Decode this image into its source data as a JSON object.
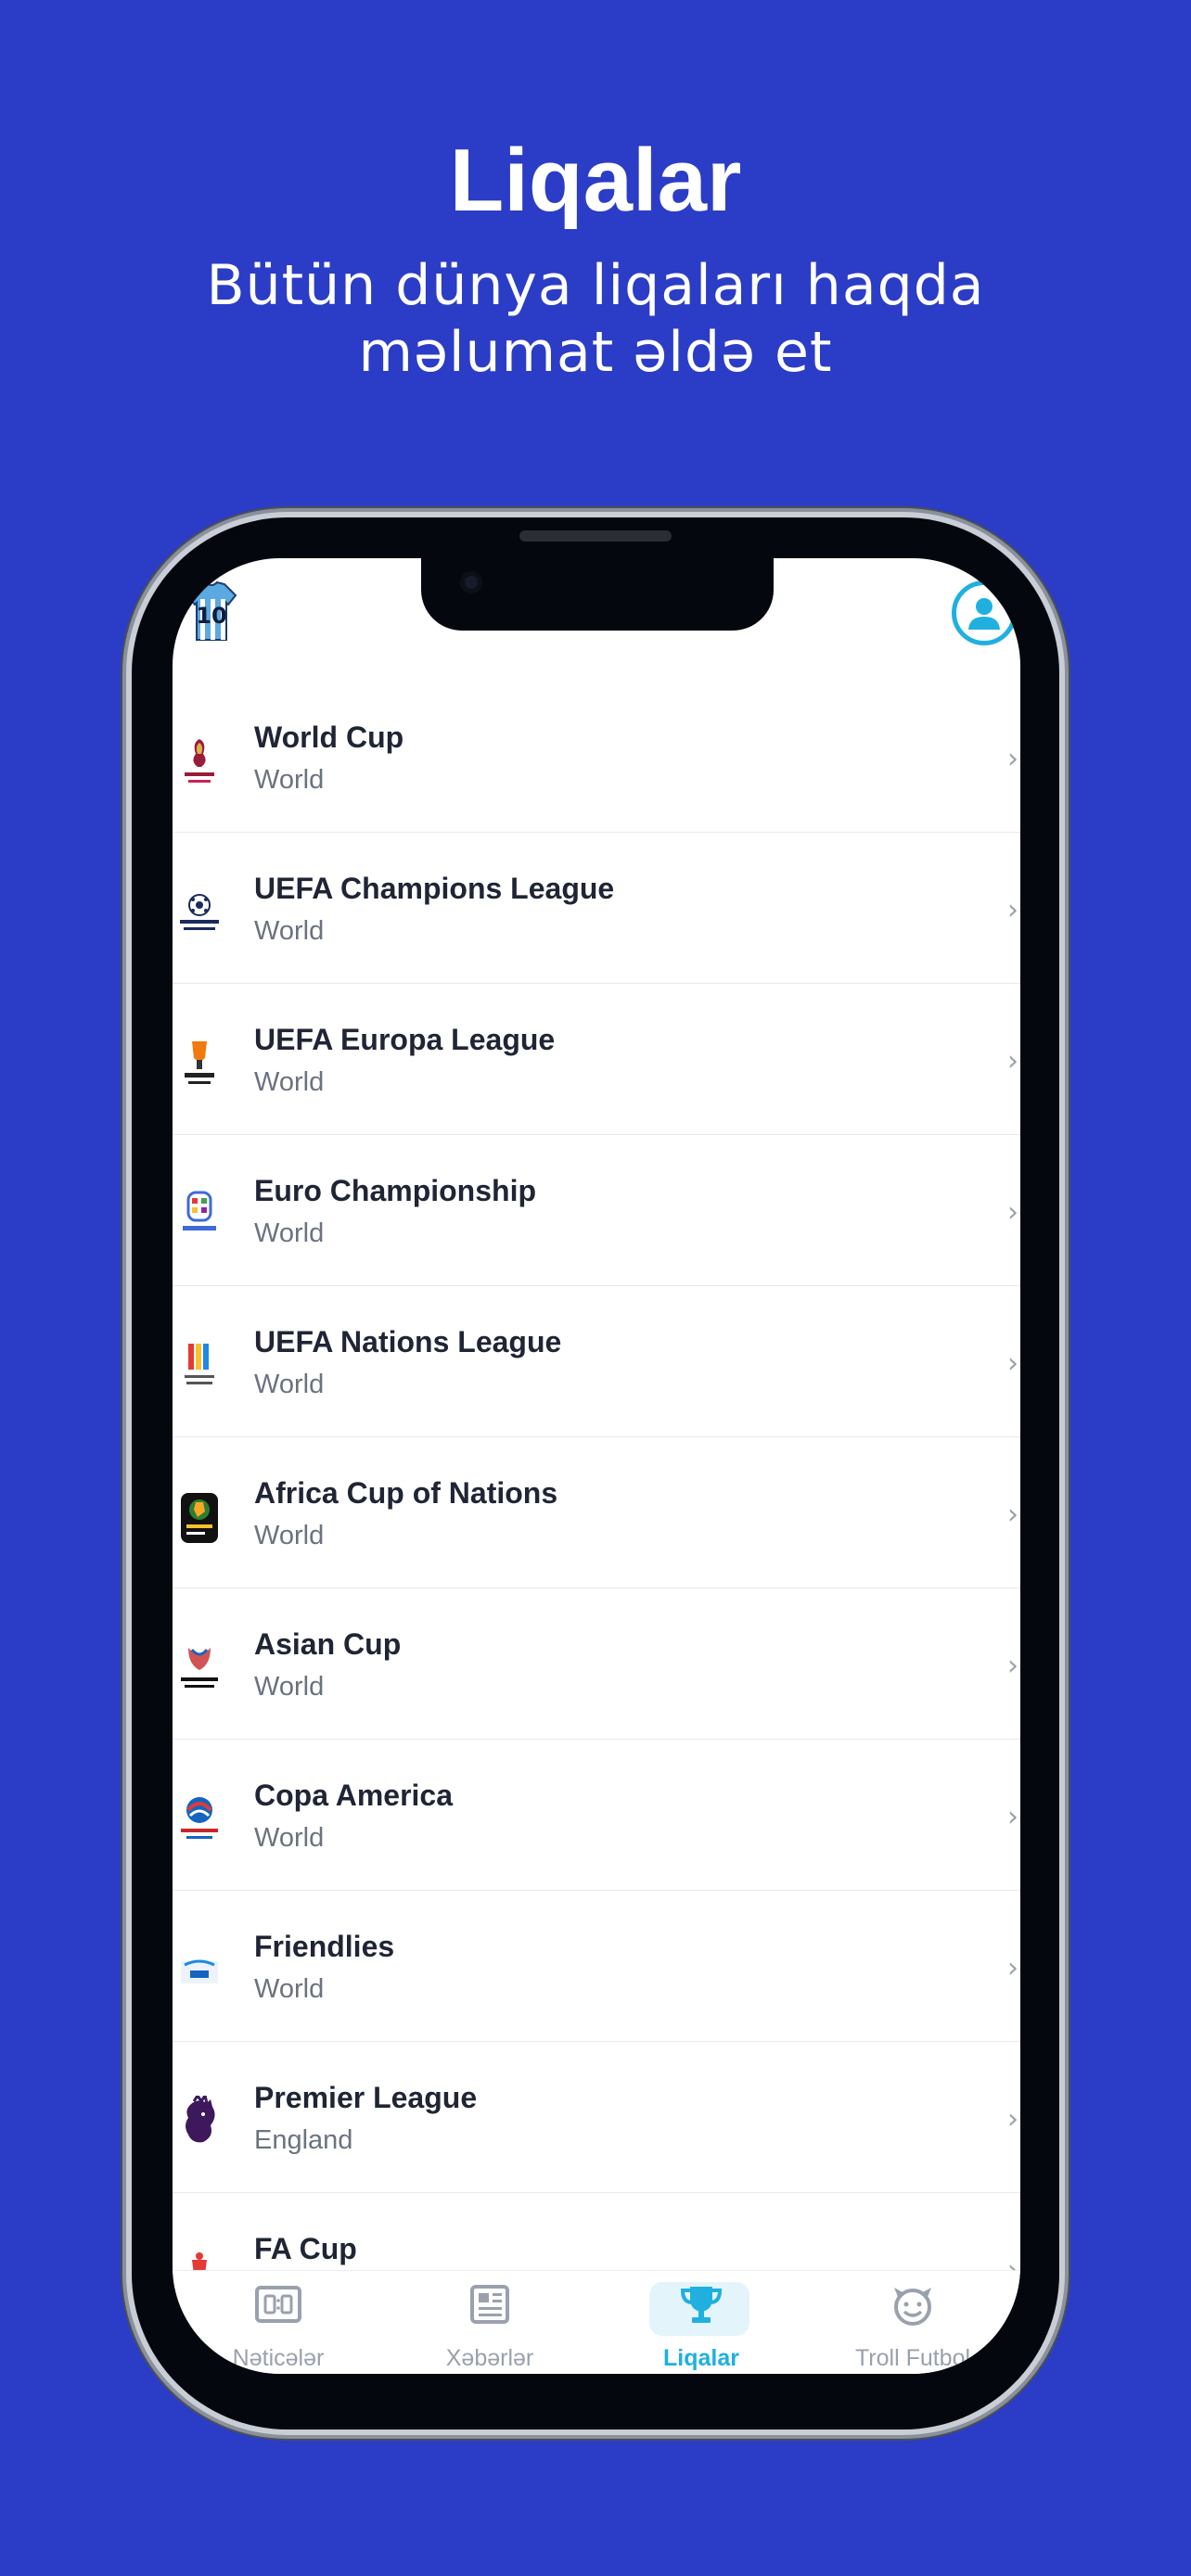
{
  "promo": {
    "title": "Liqalar",
    "subtitle_line1": "Bütün dünya liqaları haqda",
    "subtitle_line2": "məlumat əldə et"
  },
  "header": {
    "jersey_number": "10"
  },
  "leagues": [
    {
      "name": "World Cup",
      "country": "World",
      "icon": "world-cup-logo"
    },
    {
      "name": "UEFA Champions League",
      "country": "World",
      "icon": "champions-league-logo"
    },
    {
      "name": "UEFA Europa League",
      "country": "World",
      "icon": "europa-league-logo"
    },
    {
      "name": "Euro Championship",
      "country": "World",
      "icon": "euro-2024-logo"
    },
    {
      "name": "UEFA Nations League",
      "country": "World",
      "icon": "nations-league-logo"
    },
    {
      "name": "Africa Cup of Nations",
      "country": "World",
      "icon": "caf-logo"
    },
    {
      "name": "Asian Cup",
      "country": "World",
      "icon": "afc-asian-cup-logo"
    },
    {
      "name": "Copa America",
      "country": "World",
      "icon": "copa-america-logo"
    },
    {
      "name": "Friendlies",
      "country": "World",
      "icon": "fifa-logo"
    },
    {
      "name": "Premier League",
      "country": "England",
      "icon": "premier-league-logo"
    },
    {
      "name": "FA Cup",
      "country": "",
      "icon": "fa-cup-logo"
    }
  ],
  "tabs": [
    {
      "label": "Nəticələr",
      "icon": "scoreboard-icon",
      "active": false
    },
    {
      "label": "Xəbərlər",
      "icon": "newspaper-icon",
      "active": false
    },
    {
      "label": "Liqalar",
      "icon": "trophy-icon",
      "active": true
    },
    {
      "label": "Troll Futbol",
      "icon": "troll-face-icon",
      "active": false
    }
  ],
  "colors": {
    "background": "#2b3dc6",
    "accent": "#1fb0e0",
    "text_primary": "#1f2535",
    "text_secondary": "#6b7280"
  }
}
